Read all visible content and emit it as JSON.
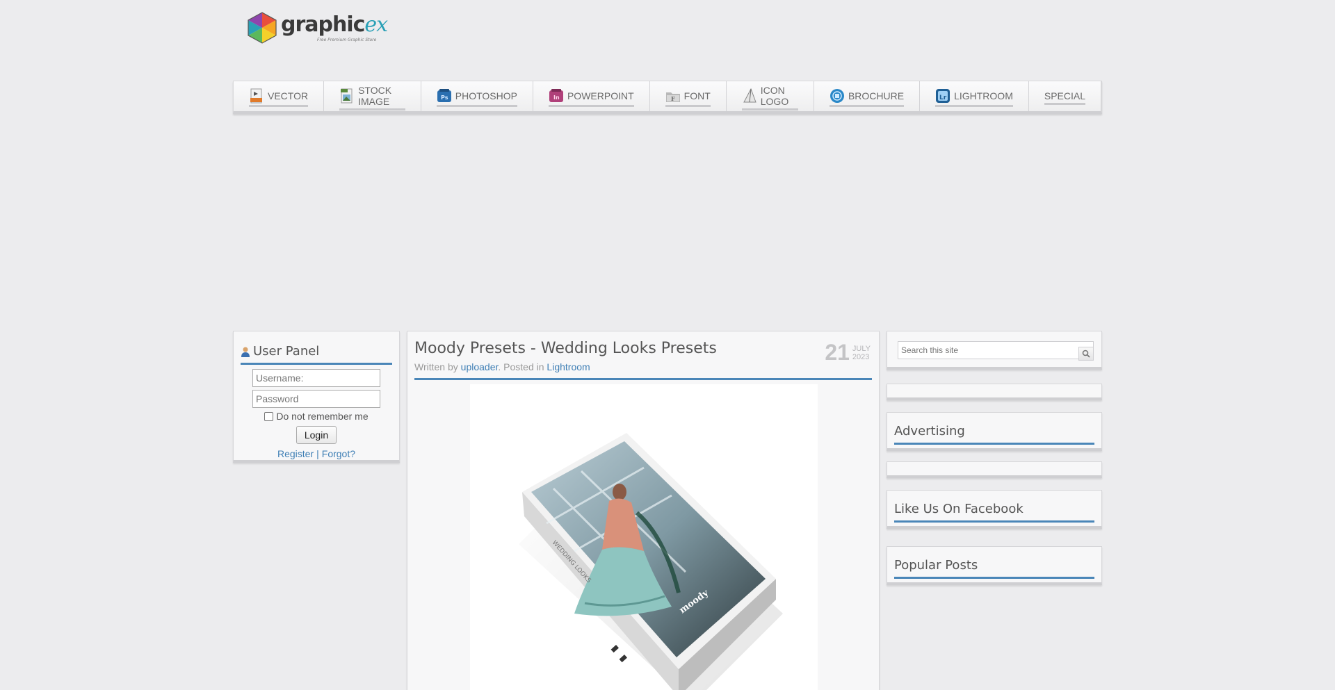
{
  "logo": {
    "word_main": "graphic",
    "word_accent": "ex",
    "tagline": "Free Premium Graphic Store"
  },
  "nav": {
    "items": [
      {
        "label": "VECTOR",
        "icon": "eps-file-icon",
        "color": "#e07a2a"
      },
      {
        "label": "STOCK IMAGE",
        "icon": "jpg-image-icon",
        "color": "#5a8a3c"
      },
      {
        "label": "PHOTOSHOP",
        "icon": "photoshop-icon",
        "color": "#2a6fb0"
      },
      {
        "label": "POWERPOINT",
        "icon": "powerpoint-icon",
        "color": "#b0407a"
      },
      {
        "label": "FONT",
        "icon": "font-folder-icon",
        "color": "#999999"
      },
      {
        "label": "ICON LOGO",
        "icon": "pen-nib-icon",
        "color": "#777777"
      },
      {
        "label": "BROCHURE",
        "icon": "brochure-globe-icon",
        "color": "#2a88c8"
      },
      {
        "label": "LIGHTROOM",
        "icon": "lightroom-icon",
        "color": "#1f5f95"
      },
      {
        "label": "SPECIAL",
        "icon": "",
        "color": ""
      }
    ]
  },
  "user_panel": {
    "title": "User Panel",
    "username_placeholder": "Username:",
    "password_placeholder": "Password",
    "remember_label": "Do not remember me",
    "login_label": "Login",
    "register_label": "Register",
    "separator": "|",
    "forgot_label": "Forgot?"
  },
  "post": {
    "title": "Moody Presets - Wedding Looks Presets",
    "written_by": "Written by",
    "author": "uploader",
    "posted_in": ". Posted in",
    "category": "Lightroom",
    "date_day": "21",
    "date_month": "JULY",
    "date_year": "2023",
    "box_brand": "moody",
    "box_text": "WEDDING LOOKS"
  },
  "sidebar": {
    "search_placeholder": "Search this site",
    "advertising_title": "Advertising",
    "facebook_title": "Like Us On Facebook",
    "popular_title": "Popular Posts"
  },
  "colors": {
    "accent": "#4a86b8",
    "link": "#3f7fb5",
    "background": "#ececee"
  }
}
